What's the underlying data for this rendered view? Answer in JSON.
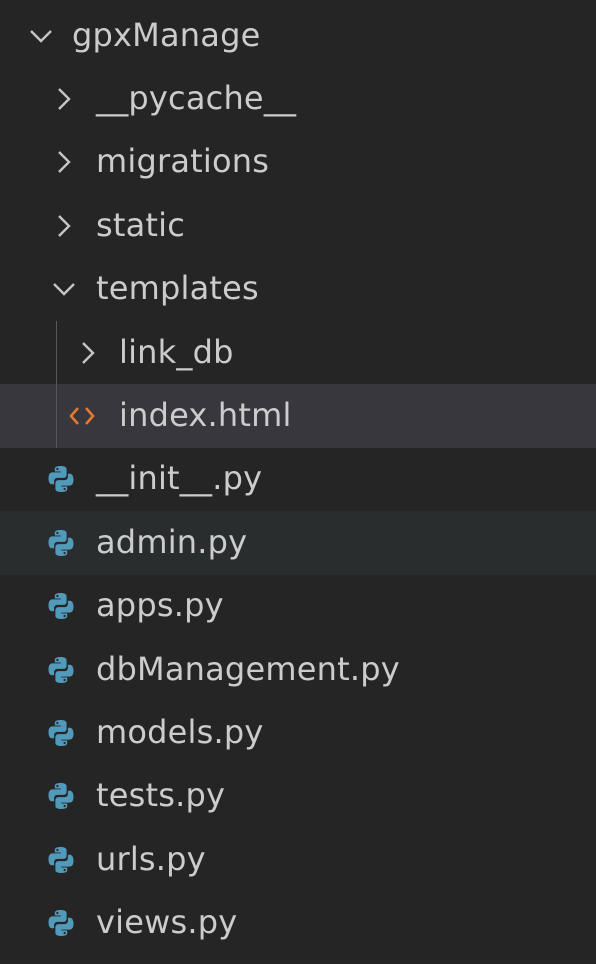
{
  "explorer": {
    "root": {
      "label": "gpxManage",
      "icon": "chevron-down-icon",
      "expanded": true
    },
    "items": [
      {
        "label": "__pycache__",
        "icon": "chevron-right-icon",
        "kind": "folder",
        "expanded": false
      },
      {
        "label": "migrations",
        "icon": "chevron-right-icon",
        "kind": "folder",
        "expanded": false
      },
      {
        "label": "static",
        "icon": "chevron-right-icon",
        "kind": "folder",
        "expanded": false
      },
      {
        "label": "templates",
        "icon": "chevron-down-icon",
        "kind": "folder",
        "expanded": true
      },
      {
        "label": "link_db",
        "icon": "chevron-right-icon",
        "kind": "folder",
        "expanded": false
      },
      {
        "label": "index.html",
        "icon": "html-file-icon",
        "kind": "file",
        "state": "selected"
      },
      {
        "label": "__init__.py",
        "icon": "python-file-icon",
        "kind": "file"
      },
      {
        "label": "admin.py",
        "icon": "python-file-icon",
        "kind": "file",
        "state": "hovered"
      },
      {
        "label": "apps.py",
        "icon": "python-file-icon",
        "kind": "file"
      },
      {
        "label": "dbManagement.py",
        "icon": "python-file-icon",
        "kind": "file"
      },
      {
        "label": "models.py",
        "icon": "python-file-icon",
        "kind": "file"
      },
      {
        "label": "tests.py",
        "icon": "python-file-icon",
        "kind": "file"
      },
      {
        "label": "urls.py",
        "icon": "python-file-icon",
        "kind": "file"
      },
      {
        "label": "views.py",
        "icon": "python-file-icon",
        "kind": "file"
      }
    ]
  },
  "colors": {
    "background": "#252526",
    "text": "#cccccc",
    "selected_row": "#37373d",
    "hover_row": "#2a2d2e",
    "python_icon": "#519aba",
    "html_icon": "#e37933",
    "chevron": "#c5c5c5"
  }
}
